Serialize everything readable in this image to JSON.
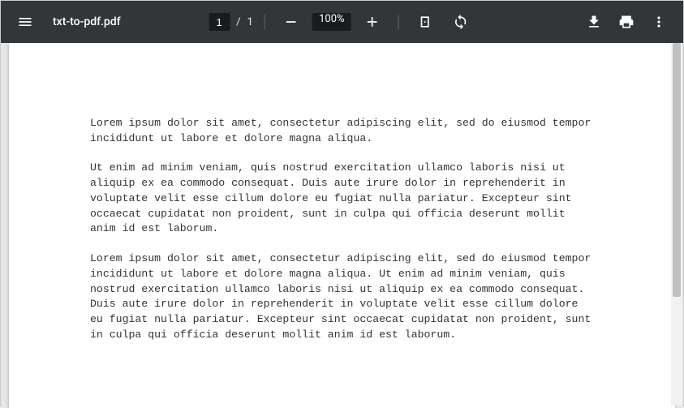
{
  "toolbar": {
    "filename": "txt-to-pdf.pdf",
    "page_current": "1",
    "page_sep": "/",
    "page_total": "1",
    "zoom_level": "100%"
  },
  "document": {
    "paragraphs": [
      "Lorem ipsum dolor sit amet, consectetur adipiscing elit, sed do eiusmod tempor incididunt ut labore et dolore magna aliqua.",
      "Ut enim ad minim veniam, quis nostrud exercitation ullamco laboris nisi ut aliquip ex ea commodo consequat. Duis aute irure dolor in reprehenderit in voluptate velit esse cillum dolore eu fugiat nulla pariatur. Excepteur sint occaecat cupidatat non proident, sunt in culpa qui officia deserunt mollit anim id est laborum.",
      "Lorem ipsum dolor sit amet, consectetur adipiscing elit, sed do eiusmod tempor incididunt ut labore et dolore magna aliqua. Ut enim ad minim veniam, quis nostrud exercitation ullamco laboris nisi ut aliquip ex ea commodo consequat. Duis aute irure dolor in reprehenderit in voluptate velit esse cillum dolore eu fugiat nulla pariatur. Excepteur sint occaecat cupidatat non proident, sunt in culpa qui officia deserunt mollit anim id est laborum."
    ]
  }
}
